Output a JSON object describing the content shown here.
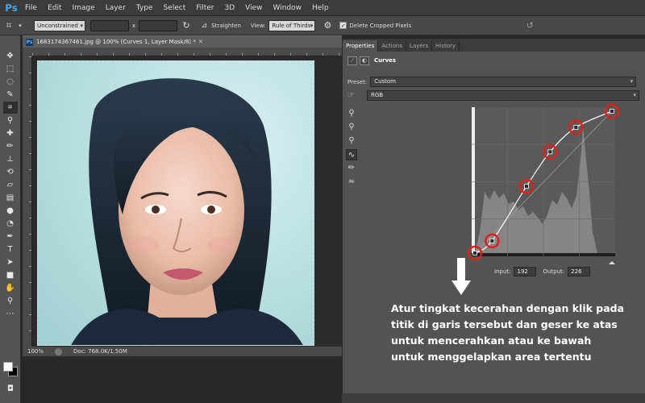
{
  "app": {
    "logo": "Ps"
  },
  "menu": [
    "File",
    "Edit",
    "Image",
    "Layer",
    "Type",
    "Select",
    "Filter",
    "3D",
    "View",
    "Window",
    "Help"
  ],
  "options": {
    "ratio": "Unconstrained",
    "swap": "x",
    "straighten": "Straighten",
    "view_label": "View:",
    "view_value": "Rule of Thirds",
    "delete_cropped": "Delete Cropped Pixels"
  },
  "document": {
    "title": "1683174367461.jpg @ 100% (Curves 1, Layer Mask/8) *",
    "zoom": "100%",
    "doc_size": "Doc: 768.0K/1,50M"
  },
  "panel": {
    "tabs": [
      "Properties",
      "Actions",
      "Layers",
      "History"
    ],
    "active_tab": "Properties",
    "title": "Curves",
    "preset_label": "Preset:",
    "preset_value": "Custom",
    "channel_value": "RGB",
    "input_label": "Input:",
    "input_value": "192",
    "output_label": "Output:",
    "output_value": "226"
  },
  "curve": {
    "points": [
      [
        0,
        0
      ],
      [
        32,
        22
      ],
      [
        96,
        120
      ],
      [
        140,
        182
      ],
      [
        188,
        226
      ],
      [
        255,
        255
      ]
    ]
  },
  "caption": [
    "Atur tingkat kecerahan dengan klik pada",
    "titik di garis tersebut dan geser ke atas",
    "untuk mencerahkan atau ke bawah",
    "untuk menggelapkan area tertentu"
  ],
  "colors": {
    "highlight": "#e0201b",
    "canvas_bg": "#bfe3e4",
    "accent": "#4aa2e6"
  }
}
